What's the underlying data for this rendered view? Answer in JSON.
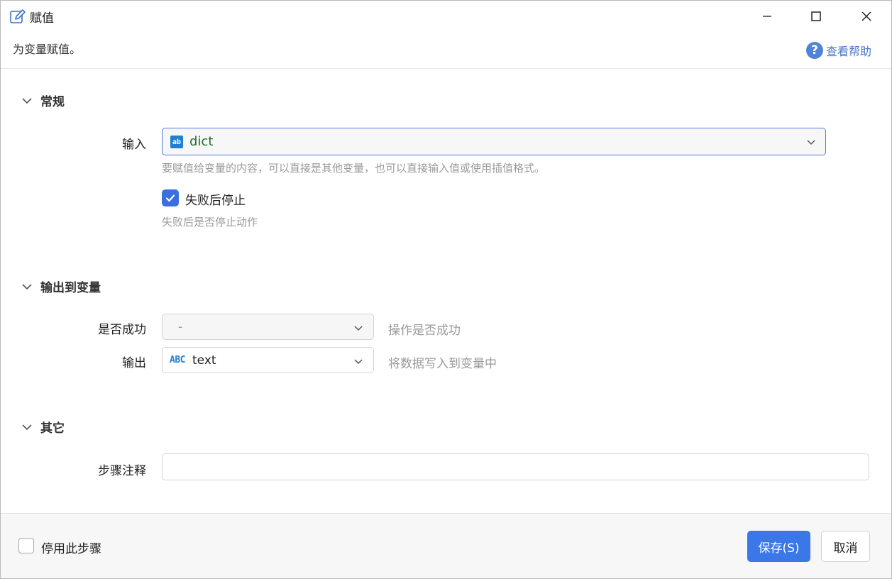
{
  "window": {
    "title": "赋值"
  },
  "header": {
    "subtitle": "为变量赋值。",
    "help_label": "查看帮助",
    "help_icon": "question-icon"
  },
  "sections": {
    "general": {
      "title": "常规",
      "input_label": "输入",
      "input_value": "dict",
      "input_hint": "要赋值给变量的内容，可以直接是其他变量，也可以直接输入值或使用插值格式。",
      "stop_on_fail_label": "失败后停止",
      "stop_on_fail_checked": true,
      "stop_on_fail_hint": "失败后是否停止动作"
    },
    "output": {
      "title": "输出到变量",
      "success_label": "是否成功",
      "success_value": "-",
      "success_hint": "操作是否成功",
      "output_label": "输出",
      "output_type_icon": "ABC",
      "output_value": "text",
      "output_hint": "将数据写入到变量中"
    },
    "other": {
      "title": "其它",
      "comment_label": "步骤注释",
      "comment_value": ""
    }
  },
  "footer": {
    "disable_step_label": "停用此步骤",
    "disable_step_checked": false,
    "save_label": "保存(S)",
    "cancel_label": "取消"
  },
  "colors": {
    "accent": "#3a78ea",
    "variable_text": "#207030",
    "hint": "#9a9a9a",
    "help_link": "#4a78c9"
  }
}
